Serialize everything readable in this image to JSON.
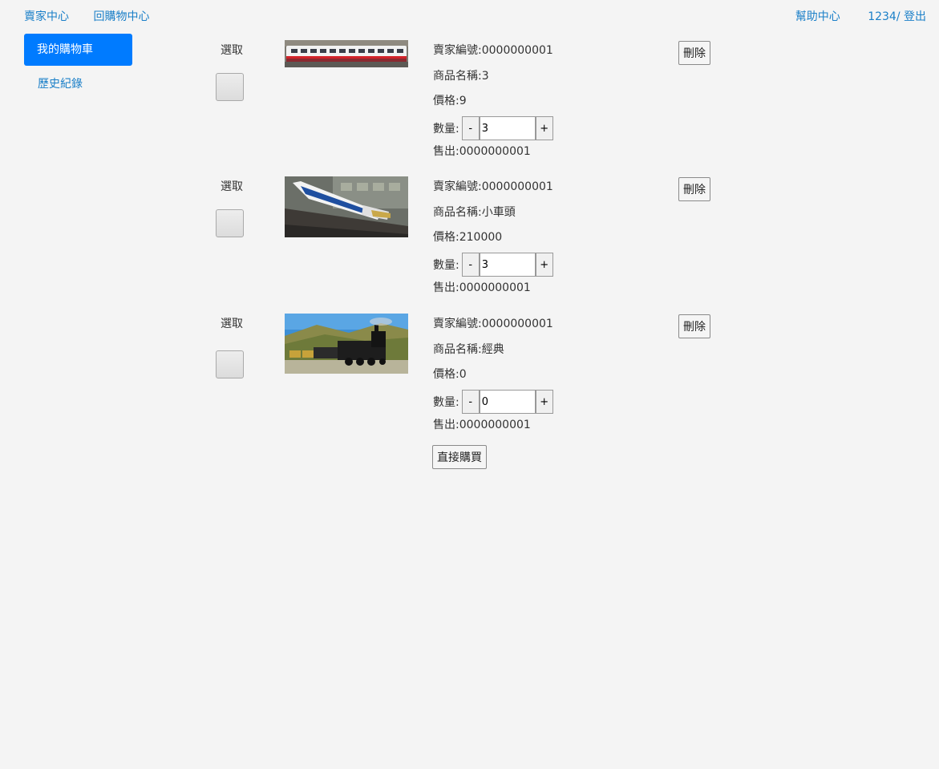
{
  "nav": {
    "seller_center": "賣家中心",
    "back_to_shop": "回購物中心",
    "help_center": "幫助中心",
    "user_logout": "1234/ 登出"
  },
  "sidebar": {
    "active": "我的購物車",
    "history": "歷史紀錄"
  },
  "cart": {
    "select_label": "選取",
    "delete_label": "刪除",
    "buy_label": "直接購買",
    "items": [
      {
        "seller": "賣家編號:0000000001",
        "name": "商品名稱:3",
        "price": "價格:9",
        "qty_label": "數量:",
        "qty": "3",
        "sold": "售出:0000000001"
      },
      {
        "seller": "賣家編號:0000000001",
        "name": "商品名稱:小車頭",
        "price": "價格:210000",
        "qty_label": "數量:",
        "qty": "3",
        "sold": "售出:0000000001"
      },
      {
        "seller": "賣家編號:0000000001",
        "name": "商品名稱:經典",
        "price": "價格:0",
        "qty_label": "數量:",
        "qty": "0",
        "sold": "售出:0000000001"
      }
    ]
  },
  "stepper": {
    "minus": "-",
    "plus": "+"
  }
}
